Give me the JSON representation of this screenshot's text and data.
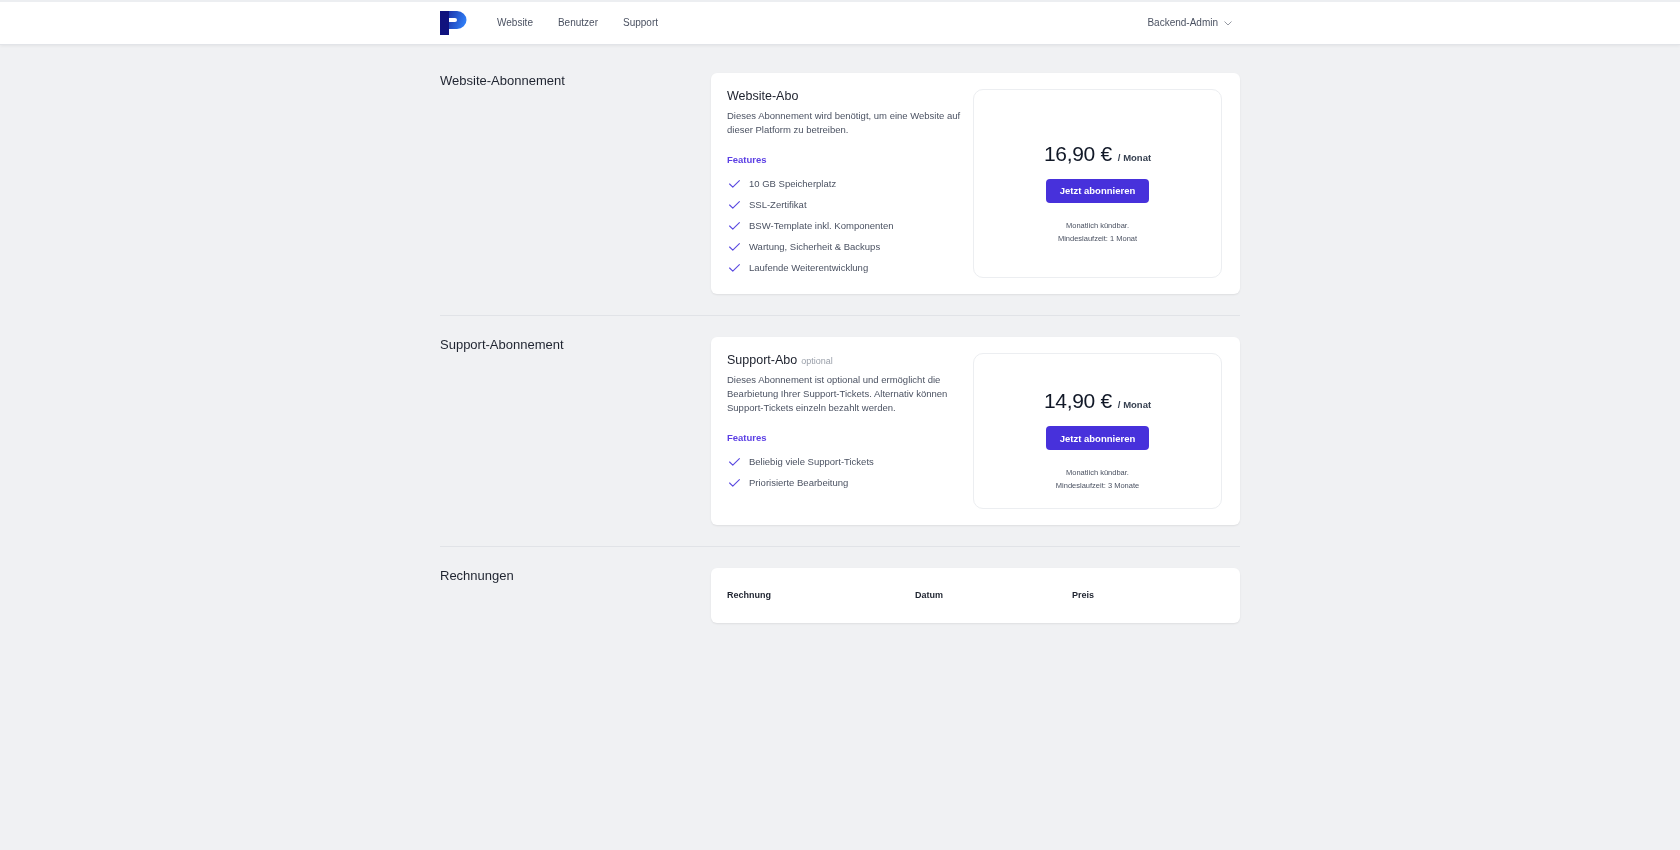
{
  "header": {
    "nav": [
      {
        "label": "Website"
      },
      {
        "label": "Benutzer"
      },
      {
        "label": "Support"
      }
    ],
    "user_menu": {
      "label": "Backend-Admin"
    }
  },
  "sections": [
    {
      "kind": "plan",
      "heading": "Website-Abonnement",
      "plan": {
        "title": "Website-Abo",
        "description": "Dieses Abonnement wird benötigt, um eine Website auf dieser Platform zu betreiben.",
        "features_heading": "Features",
        "features": [
          "10 GB Speicherplatz",
          "SSL-Zertifikat",
          "BSW-Template inkl. Komponenten",
          "Wartung, Sicherheit & Backups",
          "Laufende Weiterentwicklung"
        ],
        "price": "16,90 €",
        "period": "/ Monat",
        "button": "Jetzt abonnieren",
        "notes": [
          "Monatlich kündbar.",
          "Mindeslaufzeit: 1 Monat"
        ]
      }
    },
    {
      "kind": "plan",
      "heading": "Support-Abonnement",
      "plan": {
        "title": "Support-Abo",
        "badge": "optional",
        "description": "Dieses Abonnement ist optional und ermöglicht die Bearbietung Ihrer Support-Tickets. Alternativ können Support-Tickets einzeln bezahlt werden.",
        "features_heading": "Features",
        "features": [
          "Beliebig viele Support-Tickets",
          "Priorisierte Bearbeitung"
        ],
        "price": "14,90 €",
        "period": "/ Monat",
        "button": "Jetzt abonnieren",
        "notes": [
          "Monatlich kündbar.",
          "Mindeslaufzeit: 3 Monate"
        ]
      }
    },
    {
      "kind": "table",
      "heading": "Rechnungen",
      "table": {
        "columns": [
          "Rechnung",
          "Datum",
          "Preis"
        ]
      }
    }
  ]
}
